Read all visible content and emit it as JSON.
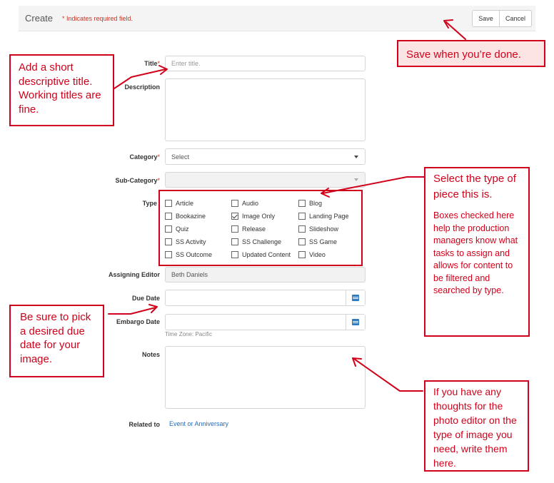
{
  "header": {
    "title": "Create",
    "required_note": "* Indicates required field.",
    "save_label": "Save",
    "cancel_label": "Cancel"
  },
  "form": {
    "title_label": "Title",
    "title_placeholder": "Enter title.",
    "description_label": "Description",
    "category_label": "Category",
    "category_value": "Select",
    "subcategory_label": "Sub-Category",
    "type_label": "Type",
    "type_options": [
      {
        "label": "Article",
        "checked": false
      },
      {
        "label": "Audio",
        "checked": false
      },
      {
        "label": "Blog",
        "checked": false
      },
      {
        "label": "Bookazine",
        "checked": false
      },
      {
        "label": "Image Only",
        "checked": true
      },
      {
        "label": "Landing Page",
        "checked": false
      },
      {
        "label": "Quiz",
        "checked": false
      },
      {
        "label": "Release",
        "checked": false
      },
      {
        "label": "Slideshow",
        "checked": false
      },
      {
        "label": "SS Activity",
        "checked": false
      },
      {
        "label": "SS Challenge",
        "checked": false
      },
      {
        "label": "SS Game",
        "checked": false
      },
      {
        "label": "SS Outcome",
        "checked": false
      },
      {
        "label": "Updated Content",
        "checked": false
      },
      {
        "label": "Video",
        "checked": false
      }
    ],
    "assigning_editor_label": "Assigning Editor",
    "assigning_editor_value": "Beth Daniels",
    "due_date_label": "Due Date",
    "embargo_date_label": "Embargo Date",
    "timezone_note": "Time Zone: Pacific",
    "notes_label": "Notes",
    "related_label": "Related to",
    "related_link": "Event or Anniversary"
  },
  "annotations": {
    "save_hint": "Save when you’re done.",
    "title_hint": "Add a short descriptive title. Working titles are fine.",
    "type_hint_title": "Select the type of piece this is.",
    "type_hint_body": "Boxes checked here help the production managers know what tasks to assign and allows for content to be filtered and searched by type.",
    "due_date_hint": "Be sure to pick a desired due date for your image.",
    "notes_hint": "If you have any thoughts for the photo editor on the type of image you need, write them here."
  },
  "colors": {
    "annotation_red": "#d0021b",
    "required_red": "#c0392b",
    "link_blue": "#2a6cb8",
    "calendar_blue": "#2f7bbf"
  }
}
